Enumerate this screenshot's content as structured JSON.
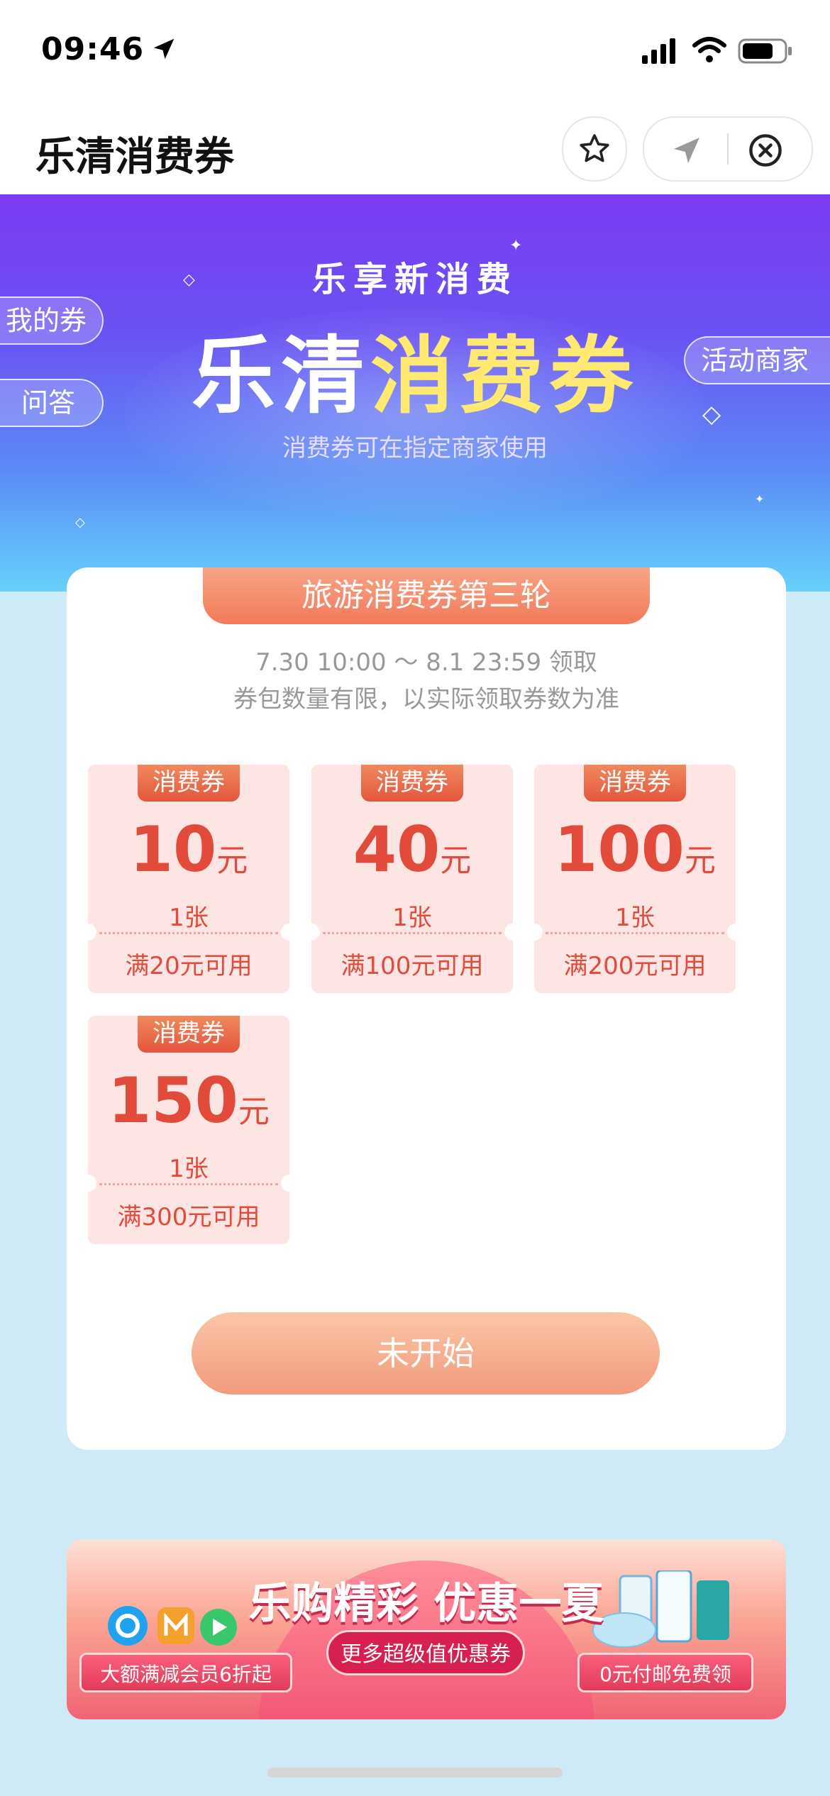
{
  "status_bar": {
    "time": "09:46"
  },
  "nav": {
    "title": "乐清消费券"
  },
  "hero": {
    "subtitle": "乐享新消费",
    "title_part1": "乐清",
    "title_part2": "消费券",
    "description": "消费券可在指定商家使用",
    "my_coupons_label": "我的券",
    "faq_label": "问答",
    "merchants_label": "活动商家"
  },
  "campaign": {
    "title": "旅游消费券第三轮",
    "period": "7.30 10:00 ～ 8.1 23:59 领取",
    "note": "券包数量有限，以实际领取券数为准",
    "coupons": [
      {
        "tag": "消费券",
        "amount": "10",
        "unit": "元",
        "quantity": "1张",
        "condition": "满20元可用"
      },
      {
        "tag": "消费券",
        "amount": "40",
        "unit": "元",
        "quantity": "1张",
        "condition": "满100元可用"
      },
      {
        "tag": "消费券",
        "amount": "100",
        "unit": "元",
        "quantity": "1张",
        "condition": "满200元可用"
      },
      {
        "tag": "消费券",
        "amount": "150",
        "unit": "元",
        "quantity": "1张",
        "condition": "满300元可用"
      }
    ],
    "button_label": "未开始"
  },
  "banner": {
    "headline": "乐购精彩 优惠一夏",
    "center_button": "更多超级值优惠券",
    "left_button": "大额满减会员6折起",
    "right_button": "0元付邮免费领"
  },
  "colors": {
    "accent_red": "#e24a3a",
    "coupon_bg": "#fde5e3",
    "hero_top": "#7b3bf2",
    "hero_bottom": "#66d2fa"
  }
}
